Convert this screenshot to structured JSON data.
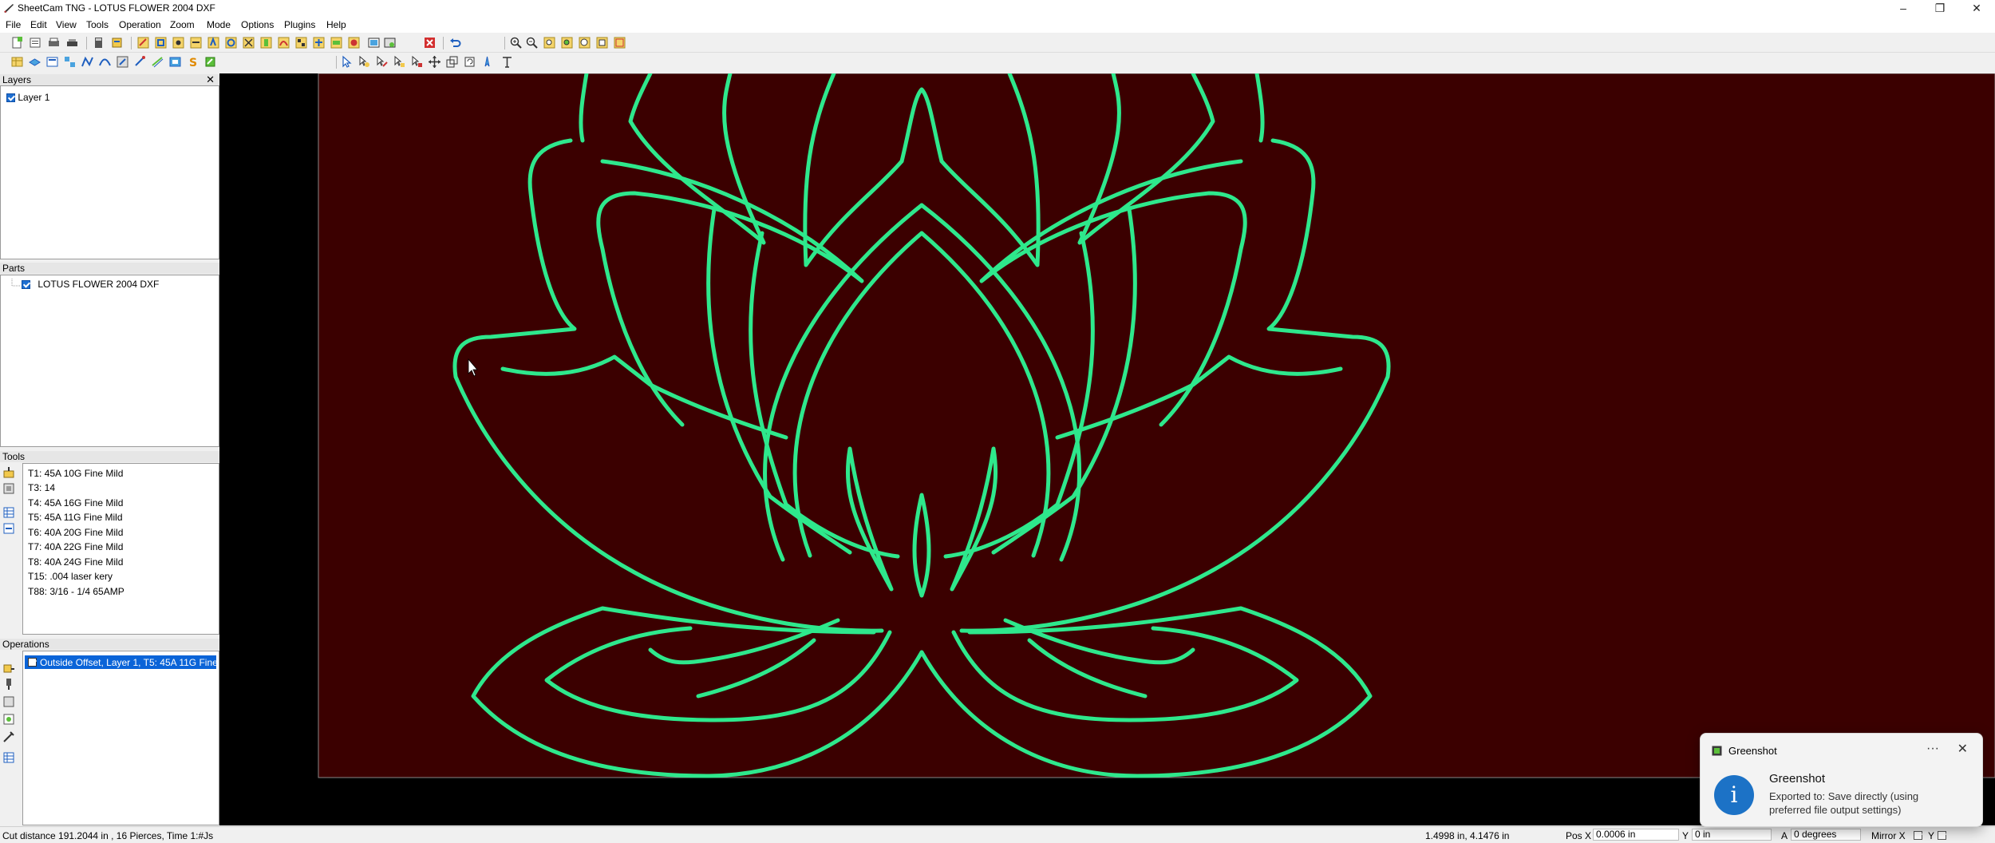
{
  "window": {
    "title": "SheetCam TNG - LOTUS FLOWER 2004 DXF",
    "controls": [
      "–",
      "❐",
      "✕"
    ]
  },
  "menu": [
    "File",
    "Edit",
    "View",
    "Tools",
    "Operation",
    "Zoom",
    "Mode",
    "Options",
    "Plugins",
    "Help"
  ],
  "layers": {
    "title": "Layers",
    "close": "✕",
    "items": [
      {
        "label": "Layer 1",
        "checked": true
      }
    ]
  },
  "parts": {
    "title": "Parts",
    "items": [
      {
        "label": "LOTUS FLOWER 2004 DXF",
        "checked": true
      }
    ]
  },
  "tools": {
    "title": "Tools",
    "items": [
      "T1: 45A 10G Fine Mild",
      "T3: 14",
      "T4: 45A 16G Fine Mild",
      "T5: 45A 11G Fine Mild",
      "T6: 40A 20G Fine Mild",
      "T7: 40A 22G Fine Mild",
      "T8: 40A 24G Fine Mild",
      "T15: .004 laser kery",
      "T88: 3/16 - 1/4 65AMP"
    ]
  },
  "operations": {
    "title": "Operations",
    "items": [
      {
        "label": "Outside Offset, Layer 1, T5: 45A 11G Fine ...",
        "checked": true,
        "selected": true
      }
    ]
  },
  "drawing": {
    "background": "#3b0000",
    "outline": "#2ee88c",
    "cursor_color": "#ffffff"
  },
  "status": {
    "summary": "Cut distance 191.2044 in , 16 Pierces, Time 1:#Js",
    "coords": "1.4998 in, 4.1476 in",
    "pos_x_label": "Pos X",
    "pos_x_value": "0.0006 in",
    "y_label": "Y",
    "y_value": "0 in",
    "a_label": "A",
    "a_value": "0 degrees",
    "mirror_label": "Mirror X",
    "mirror_y_label": "Y"
  },
  "notification": {
    "app": "Greenshot",
    "more": "···",
    "close": "✕",
    "title": "Greenshot",
    "message": "Exported to: Save directly (using preferred file output settings)",
    "icon": "i"
  }
}
